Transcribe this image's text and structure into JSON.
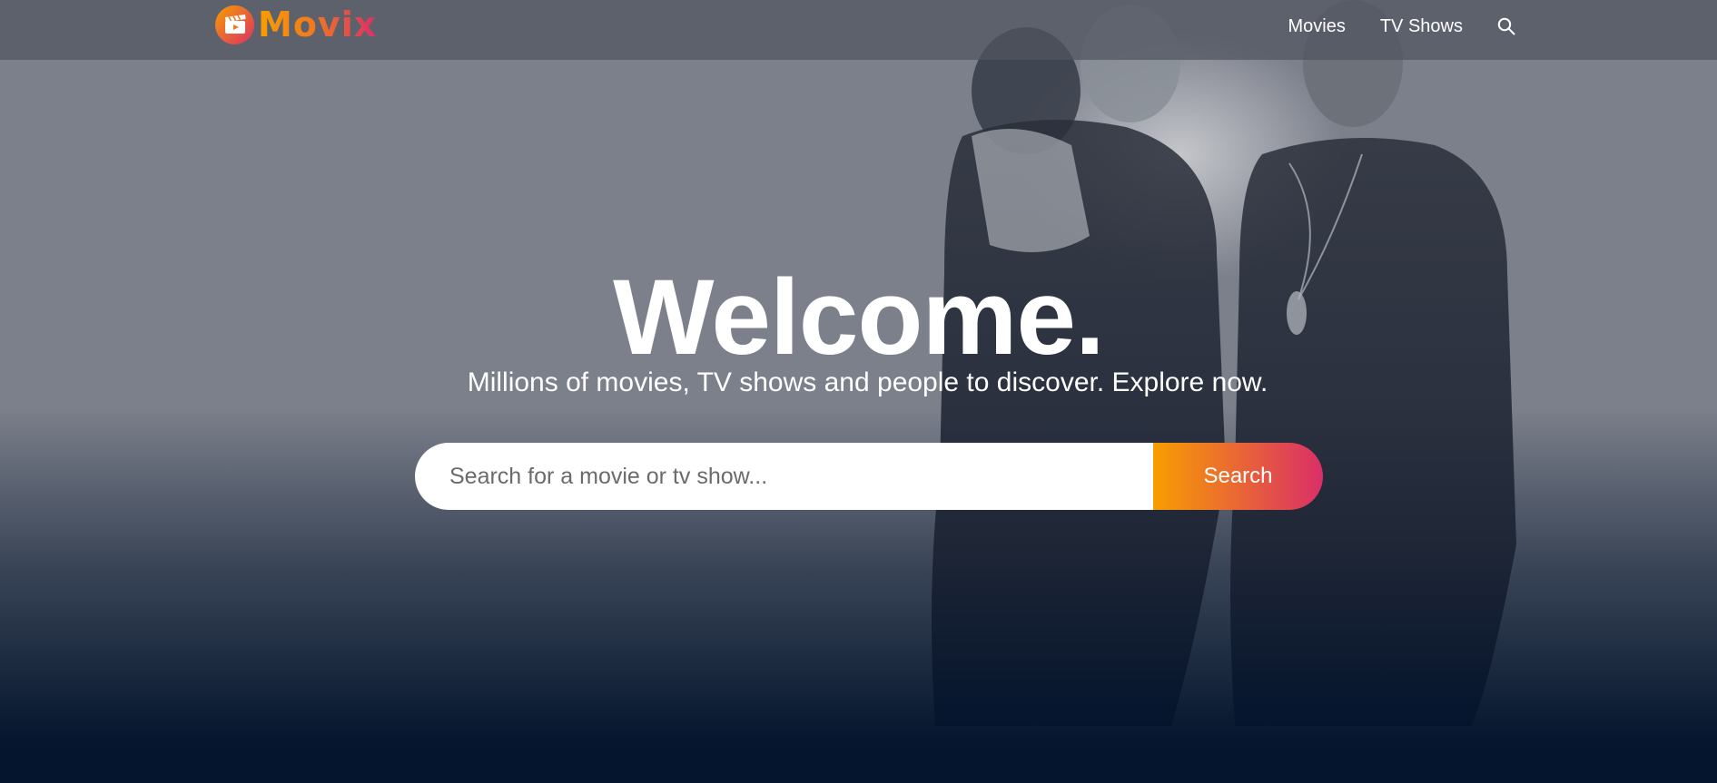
{
  "header": {
    "logo_text": "Movix",
    "nav": {
      "movies_label": "Movies",
      "tvshows_label": "TV Shows"
    }
  },
  "hero": {
    "title": "Welcome.",
    "subtitle": "Millions of movies, TV shows and people to discover. Explore now.",
    "search": {
      "placeholder": "Search for a movie or tv show...",
      "value": "",
      "button_label": "Search"
    }
  },
  "colors": {
    "gradient_start": "#f89e00",
    "gradient_end": "#da2f68",
    "background_dark": "#04152d"
  },
  "icons": [
    "logo-clapperboard-icon",
    "search-icon"
  ]
}
